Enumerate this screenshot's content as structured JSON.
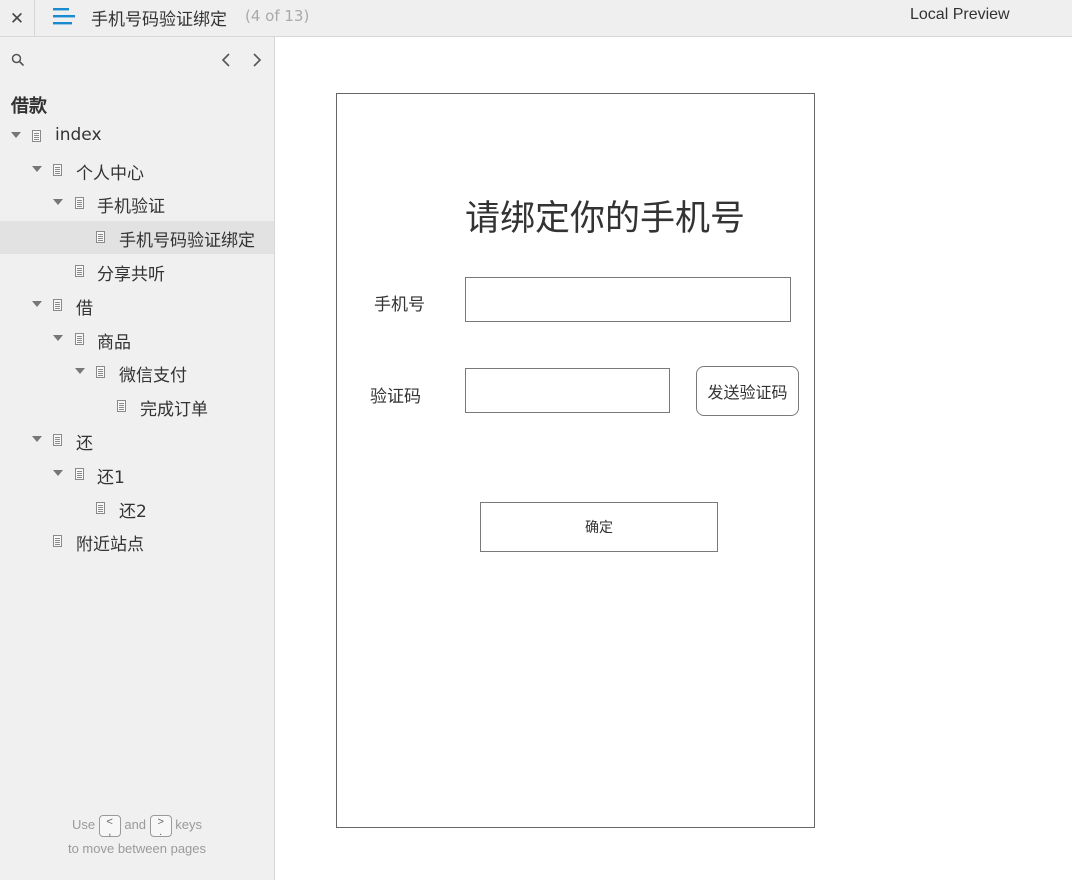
{
  "topbar": {
    "close_icon": "close-icon",
    "menu_icon": "hamburger-menu-icon",
    "page_name": "手机号码验证绑定",
    "page_count": "(4 of 13)",
    "preview_label": "Local Preview"
  },
  "sidebar": {
    "search_icon": "search-icon",
    "prev_icon": "chevron-left-icon",
    "next_icon": "chevron-right-icon",
    "project_title": "借款",
    "tree": [
      {
        "label": "index",
        "expanded": true
      },
      {
        "label": "个人中心",
        "expanded": true
      },
      {
        "label": "手机验证",
        "expanded": true
      },
      {
        "label": "手机号码验证绑定",
        "selected": true
      },
      {
        "label": "分享共听"
      },
      {
        "label": "借",
        "expanded": true
      },
      {
        "label": "商品",
        "expanded": true
      },
      {
        "label": "微信支付",
        "expanded": true
      },
      {
        "label": "完成订单"
      },
      {
        "label": "还",
        "expanded": true
      },
      {
        "label": "还1",
        "expanded": true
      },
      {
        "label": "还2"
      },
      {
        "label": "附近站点"
      }
    ],
    "hint": {
      "use": "Use",
      "prev_key": "<\n,",
      "and": "and",
      "next_key": ">\n.",
      "keys": "keys",
      "line2": "to move between pages"
    }
  },
  "form": {
    "heading": "请绑定你的手机号",
    "phone_label": "手机号",
    "phone_value": "",
    "code_label": "验证码",
    "code_value": "",
    "send_code_button": "发送验证码",
    "confirm_button": "确定"
  }
}
